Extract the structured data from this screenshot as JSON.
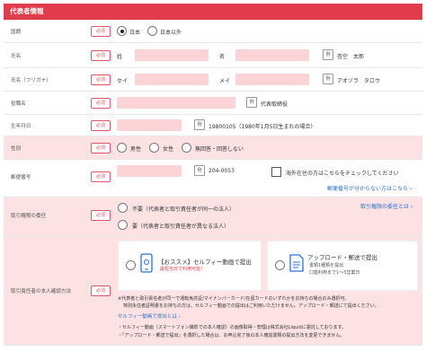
{
  "section_title": "代表者情報",
  "required_label": "必須",
  "example_label": "例",
  "country": {
    "label": "国籍",
    "options": [
      "日本",
      "日本以外"
    ],
    "selected": "日本"
  },
  "name": {
    "label": "氏名",
    "last_label": "姓",
    "first_label": "名",
    "example": "杏空　太郎"
  },
  "kana": {
    "label": "氏名（フリガナ）",
    "last_label": "セイ",
    "first_label": "メイ",
    "example": "アオゾラ　タロウ"
  },
  "position": {
    "label": "役職名",
    "example": "代表取締役"
  },
  "birthdate": {
    "label": "生年月日",
    "example": "19800105（1980年1月5日生まれの場合）"
  },
  "gender": {
    "label": "性別",
    "options": [
      "男性",
      "女性",
      "無回答・回答しない"
    ]
  },
  "postal": {
    "label": "郵便番号",
    "example": "204-0053",
    "overseas_check": "海外在住の方はこちらをチェックしてください",
    "unknown_link": "郵便番号が分からない方はこちら"
  },
  "authority": {
    "label": "取引権限の委任",
    "link": "取引権限の委任とは",
    "options": [
      "不要（代表者と取引責任者が同一の法人）",
      "要（代表者と取引責任者が異なる法人）"
    ]
  },
  "identity": {
    "label": "取引責任者の本人確認方法",
    "option1_title": "【おススメ】セルフィー動画で提出",
    "option1_sub": "最短当日で利用可能！",
    "option2_title": "アップロード・郵送で提出",
    "option2_sub1": "書類1種類を提出",
    "option2_sub2": "口座利用まで1～3営業日",
    "note1": "※代表者と取引責任者が同一で運転免許証/マイナンバーカード/在留カードのいずれかをお持ちの場合のみ選択可。",
    "note2": "特別永住者証明書をお持ちの方は、セルフィー動画での提出はご利用いただけません。アップロード・郵送にて提出ください。",
    "selfie_link": "セルフィー動画で提出とは",
    "bullet1": "・セルフィー動画（スマートフォン撮影での本人確認）の画像取得・管理は株式会社Liquidに委託しております。",
    "bullet2": "・「アップロード・郵送で提出」を選択した場合は、お申込完了後の本人確認書類の提出方法を変更できません。"
  }
}
